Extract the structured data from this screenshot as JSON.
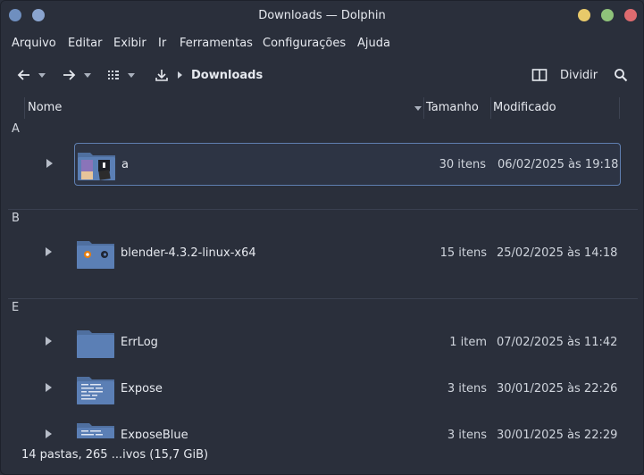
{
  "window": {
    "title": "Downloads — Dolphin"
  },
  "menubar": {
    "items": [
      "Arquivo",
      "Editar",
      "Exibir",
      "Ir",
      "Ferramentas",
      "Configurações",
      "Ajuda"
    ]
  },
  "toolbar": {
    "breadcrumb": "Downloads",
    "split_label": "Dividir"
  },
  "columns": {
    "name": "Nome",
    "size": "Tamanho",
    "modified": "Modificado"
  },
  "groups": [
    {
      "label": "A",
      "items": [
        {
          "name": "a",
          "size": "30 itens",
          "modified": "06/02/2025 às 19:18",
          "selected": true,
          "icon": "folder-thumbnails-icon"
        }
      ]
    },
    {
      "label": "B",
      "items": [
        {
          "name": "blender-4.3.2-linux-x64",
          "size": "15 itens",
          "modified": "25/02/2025 às 14:18",
          "selected": false,
          "icon": "folder-blender-icon"
        }
      ]
    },
    {
      "label": "E",
      "items": [
        {
          "name": "ErrLog",
          "size": "1 item",
          "modified": "07/02/2025 às 11:42",
          "selected": false,
          "icon": "folder-icon"
        },
        {
          "name": "Expose",
          "size": "3 itens",
          "modified": "30/01/2025 às 22:26",
          "selected": false,
          "icon": "folder-text-icon"
        },
        {
          "name": "ExposeBlue",
          "size": "3 itens",
          "modified": "30/01/2025 às 22:29",
          "selected": false,
          "icon": "folder-text-icon"
        }
      ]
    }
  ],
  "statusbar": {
    "text": "14 pastas, 265 ...ivos (15,7 GiB)"
  },
  "colors": {
    "background": "#2a2f3b",
    "selection_border": "#5f7fb0",
    "folder": "#5b7fb5",
    "close": "#de6b6f",
    "maximize": "#8fc27a",
    "minimize": "#e8c96a"
  }
}
